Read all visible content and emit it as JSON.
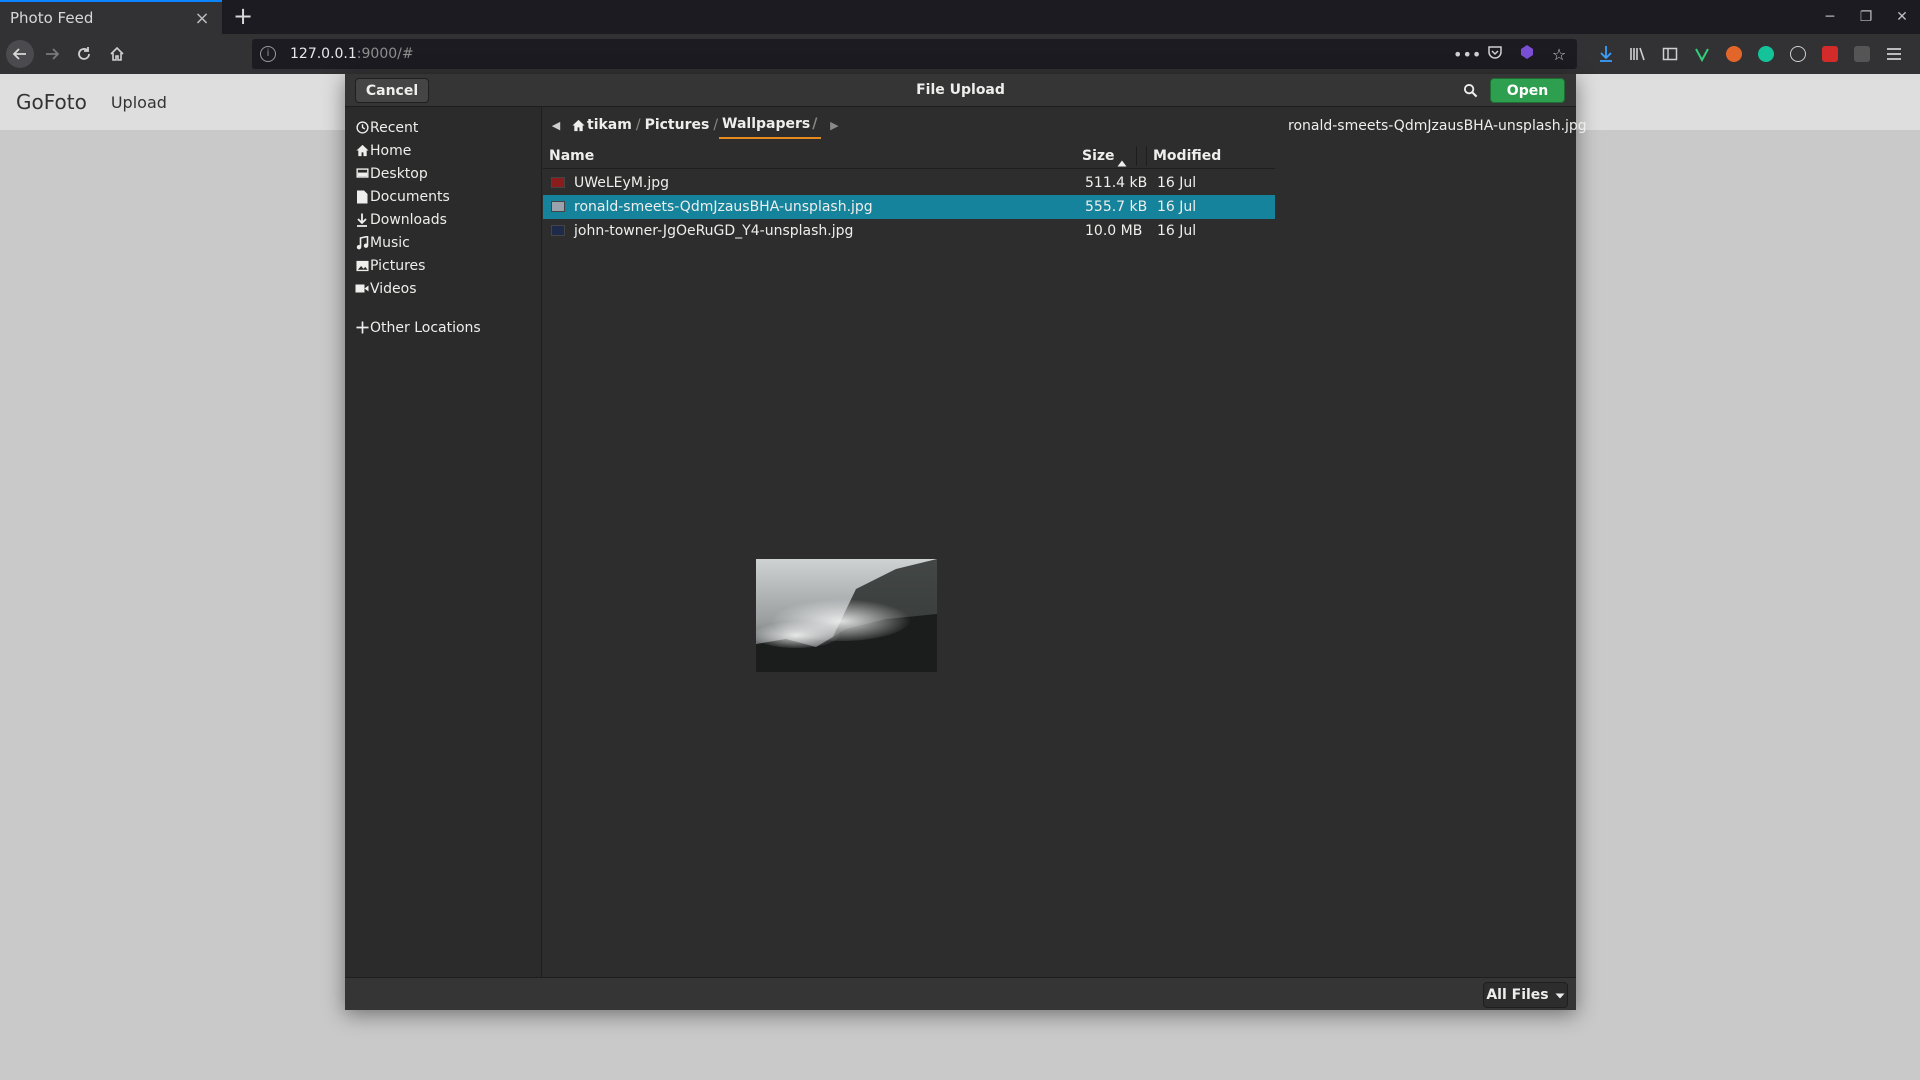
{
  "browser": {
    "tab_title": "Photo Feed",
    "url_host": "127.0.0.1",
    "url_path": ":9000/#",
    "icons": [
      "back-arrow-icon",
      "forward-arrow-icon",
      "reload-icon",
      "home-icon",
      "info-icon",
      "more-icon",
      "pocket-icon",
      "extension-icon",
      "star-icon",
      "download-icon",
      "library-icon",
      "sidebar-icon",
      "extension-v-icon",
      "extension-fox-icon",
      "grammarly-icon",
      "account-icon",
      "adblock-icon",
      "extension-sa-icon",
      "menu-icon"
    ]
  },
  "page": {
    "brand": "GoFoto",
    "nav_upload": "Upload"
  },
  "dialog": {
    "title": "File Upload",
    "cancel_label": "Cancel",
    "open_label": "Open",
    "places": [
      {
        "label": "Recent",
        "icon": "clock-icon"
      },
      {
        "label": "Home",
        "icon": "home-icon"
      },
      {
        "label": "Desktop",
        "icon": "desktop-icon"
      },
      {
        "label": "Documents",
        "icon": "document-icon"
      },
      {
        "label": "Downloads",
        "icon": "download-icon"
      },
      {
        "label": "Music",
        "icon": "music-icon"
      },
      {
        "label": "Pictures",
        "icon": "picture-icon"
      },
      {
        "label": "Videos",
        "icon": "video-icon"
      },
      {
        "label": "Other Locations",
        "icon": "plus-icon"
      }
    ],
    "breadcrumbs": [
      "tikam",
      "Pictures",
      "Wallpapers"
    ],
    "columns": {
      "name": "Name",
      "size": "Size",
      "modified": "Modified"
    },
    "files": [
      {
        "name": "UWeLEyM.jpg",
        "size": "511.4 kB",
        "modified": "16 Jul",
        "selected": false
      },
      {
        "name": "ronald-smeets-QdmJzausBHA-unsplash.jpg",
        "size": "555.7 kB",
        "modified": "16 Jul",
        "selected": true
      },
      {
        "name": "john-towner-JgOeRuGD_Y4-unsplash.jpg",
        "size": "10.0 MB",
        "modified": "16 Jul",
        "selected": false
      }
    ],
    "preview_filename": "ronald-smeets-QdmJzausBHA-unsplash.jpg",
    "filter_label": "All Files"
  },
  "colors": {
    "accent_selected": "#15839b",
    "open_button": "#2e9e4f",
    "breadcrumb_active": "#e68b1f",
    "dialog_bg": "#2d2d2d"
  }
}
